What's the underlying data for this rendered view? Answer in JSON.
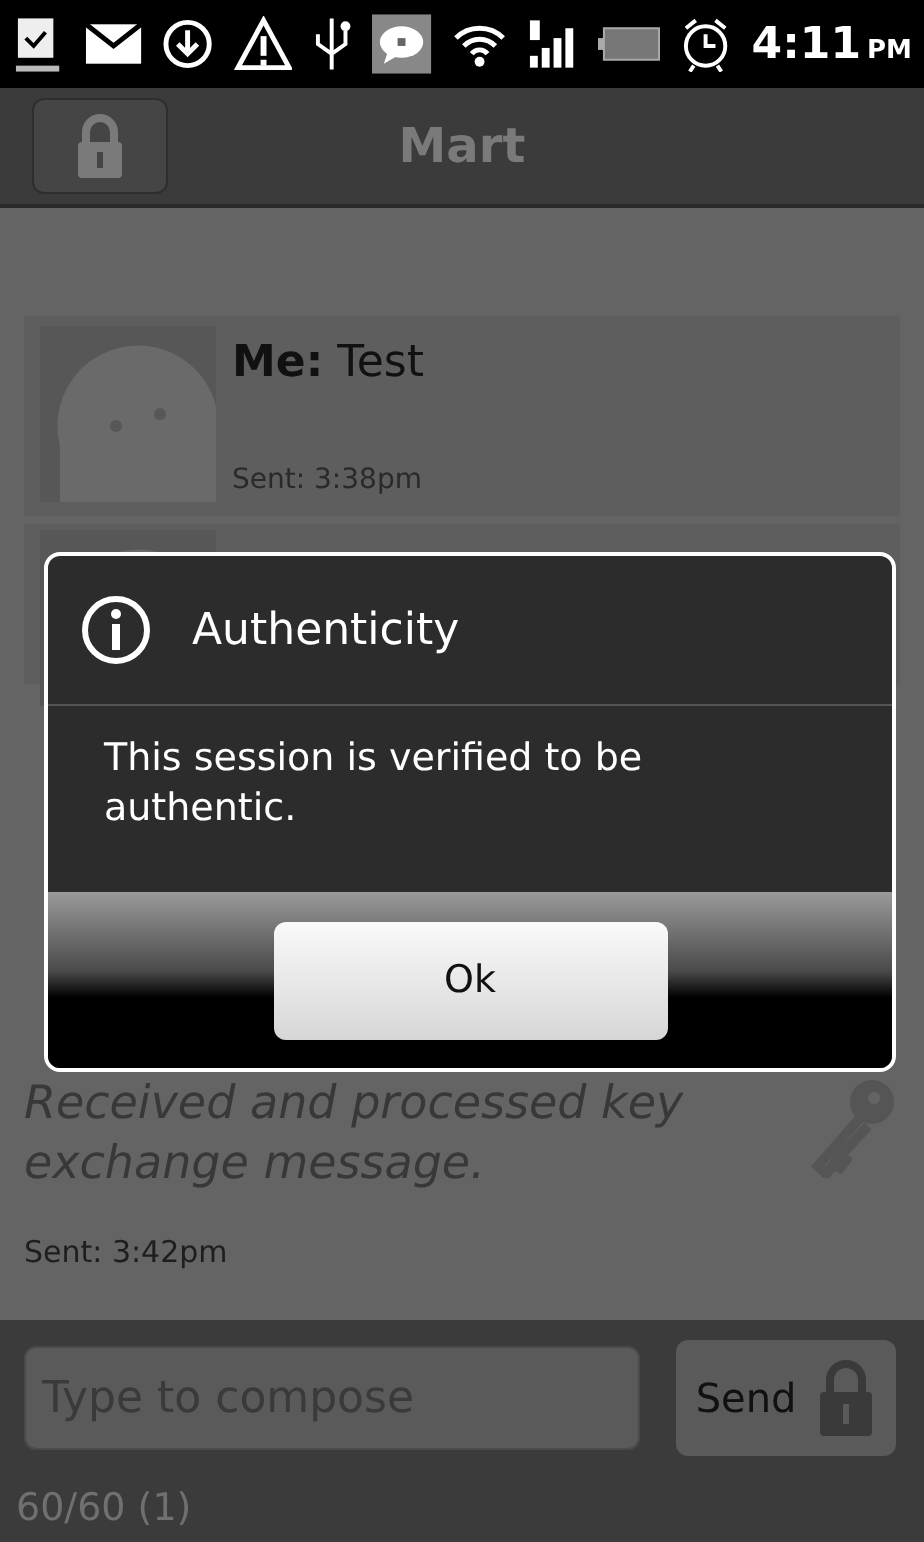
{
  "status_bar": {
    "time": "4:11",
    "ampm": "PM"
  },
  "title_bar": {
    "title": "Mart"
  },
  "messages": [
    {
      "kind": "text",
      "sender": "Me:",
      "text": "Test",
      "sent": "Sent: 3:38pm"
    },
    {
      "kind": "hidden"
    },
    {
      "kind": "key",
      "text": "Received and processed key exchange message.",
      "sent": "Sent: 3:42pm"
    }
  ],
  "dialog": {
    "title": "Authenticity",
    "message": "This session is verified to be authentic.",
    "button": "Ok"
  },
  "composer": {
    "placeholder": "Type to compose",
    "send": "Send",
    "counter": "60/60 (1)"
  }
}
